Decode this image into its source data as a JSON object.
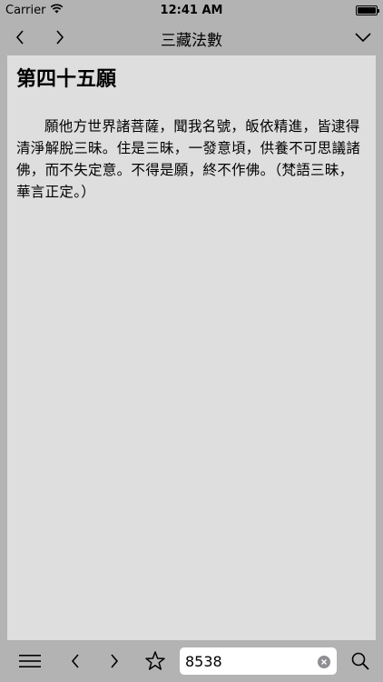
{
  "status_bar": {
    "carrier": "Carrier",
    "time": "12:41 AM"
  },
  "nav": {
    "title": "三藏法數"
  },
  "content": {
    "heading": "第四十五願",
    "body": "願他方世界諸菩薩，聞我名號，皈依精進，皆逮得清淨解脫三昧。住是三昧，一發意頃，供養不可思議諸佛，而不失定意。不得是願，終不作佛。（梵語三昧，華言正定。）"
  },
  "toolbar": {
    "search_value": "8538"
  },
  "icons": {
    "wifi": "wifi-icon",
    "battery": "battery-icon",
    "back": "chevron-left-icon",
    "forward": "chevron-right-icon",
    "dropdown": "chevron-down-icon",
    "menu": "hamburger-menu-icon",
    "bookmark": "star-icon",
    "clear": "clear-circle-icon",
    "search": "search-icon"
  }
}
